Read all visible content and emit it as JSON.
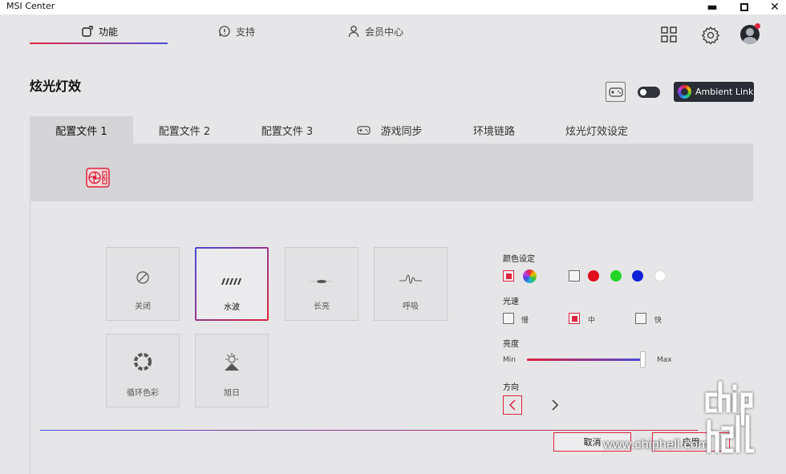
{
  "window": {
    "title": "MSI Center",
    "minimize": "▬",
    "maximize": "☐",
    "close": "✕"
  },
  "nav": {
    "items": [
      {
        "label": "功能",
        "icon": "feature-icon",
        "active": true
      },
      {
        "label": "支持",
        "icon": "support-icon",
        "active": false
      },
      {
        "label": "会员中心",
        "icon": "member-icon",
        "active": false
      }
    ]
  },
  "topbar": {
    "icons": [
      "grid-icon",
      "gear-icon",
      "avatar"
    ],
    "notification": true
  },
  "page": {
    "title": "炫光灯效"
  },
  "header_controls": {
    "ambient_link_label": "Ambient Link",
    "toggle_on": false
  },
  "tabs": [
    {
      "label": "配置文件 1",
      "active": true
    },
    {
      "label": "配置文件 2",
      "active": false
    },
    {
      "label": "配置文件 3",
      "active": false
    },
    {
      "label": "游戏同步",
      "active": false,
      "icon": "gamepad-icon"
    },
    {
      "label": "环境链路",
      "active": false
    },
    {
      "label": "炫光灯效设定",
      "active": false
    }
  ],
  "effects": [
    {
      "label": "关闭",
      "icon": "off-icon",
      "selected": false
    },
    {
      "label": "水波",
      "icon": "wave-icon",
      "selected": true
    },
    {
      "label": "长亮",
      "icon": "steady-icon",
      "selected": false
    },
    {
      "label": "呼吸",
      "icon": "breathing-icon",
      "selected": false
    },
    {
      "label": "循环色彩",
      "icon": "color-cycle-icon",
      "selected": false
    },
    {
      "label": "旭日",
      "icon": "sunrise-icon",
      "selected": false
    }
  ],
  "settings": {
    "color": {
      "label": "颜色设定",
      "mode_checked": "custom",
      "swatches": [
        "#e0101e",
        "#22d428",
        "#1020d8",
        "#ffffff"
      ]
    },
    "speed": {
      "label": "光速",
      "options": [
        {
          "label": "慢",
          "checked": false
        },
        {
          "label": "中",
          "checked": true
        },
        {
          "label": "快",
          "checked": false
        }
      ]
    },
    "brightness": {
      "label": "亮度",
      "min_label": "Min",
      "max_label": "Max",
      "value_percent": 100
    },
    "direction": {
      "label": "方向",
      "left": "‹",
      "right": "›",
      "selected": "left"
    }
  },
  "footer": {
    "cancel": "取消",
    "apply": "应用"
  },
  "watermark": {
    "text": "www.chiphell.com",
    "logo": "chip hell"
  },
  "colors": {
    "accent_red": "#e0233c",
    "accent_blue": "#4a4bd8",
    "bg": "#e6e6e8"
  }
}
